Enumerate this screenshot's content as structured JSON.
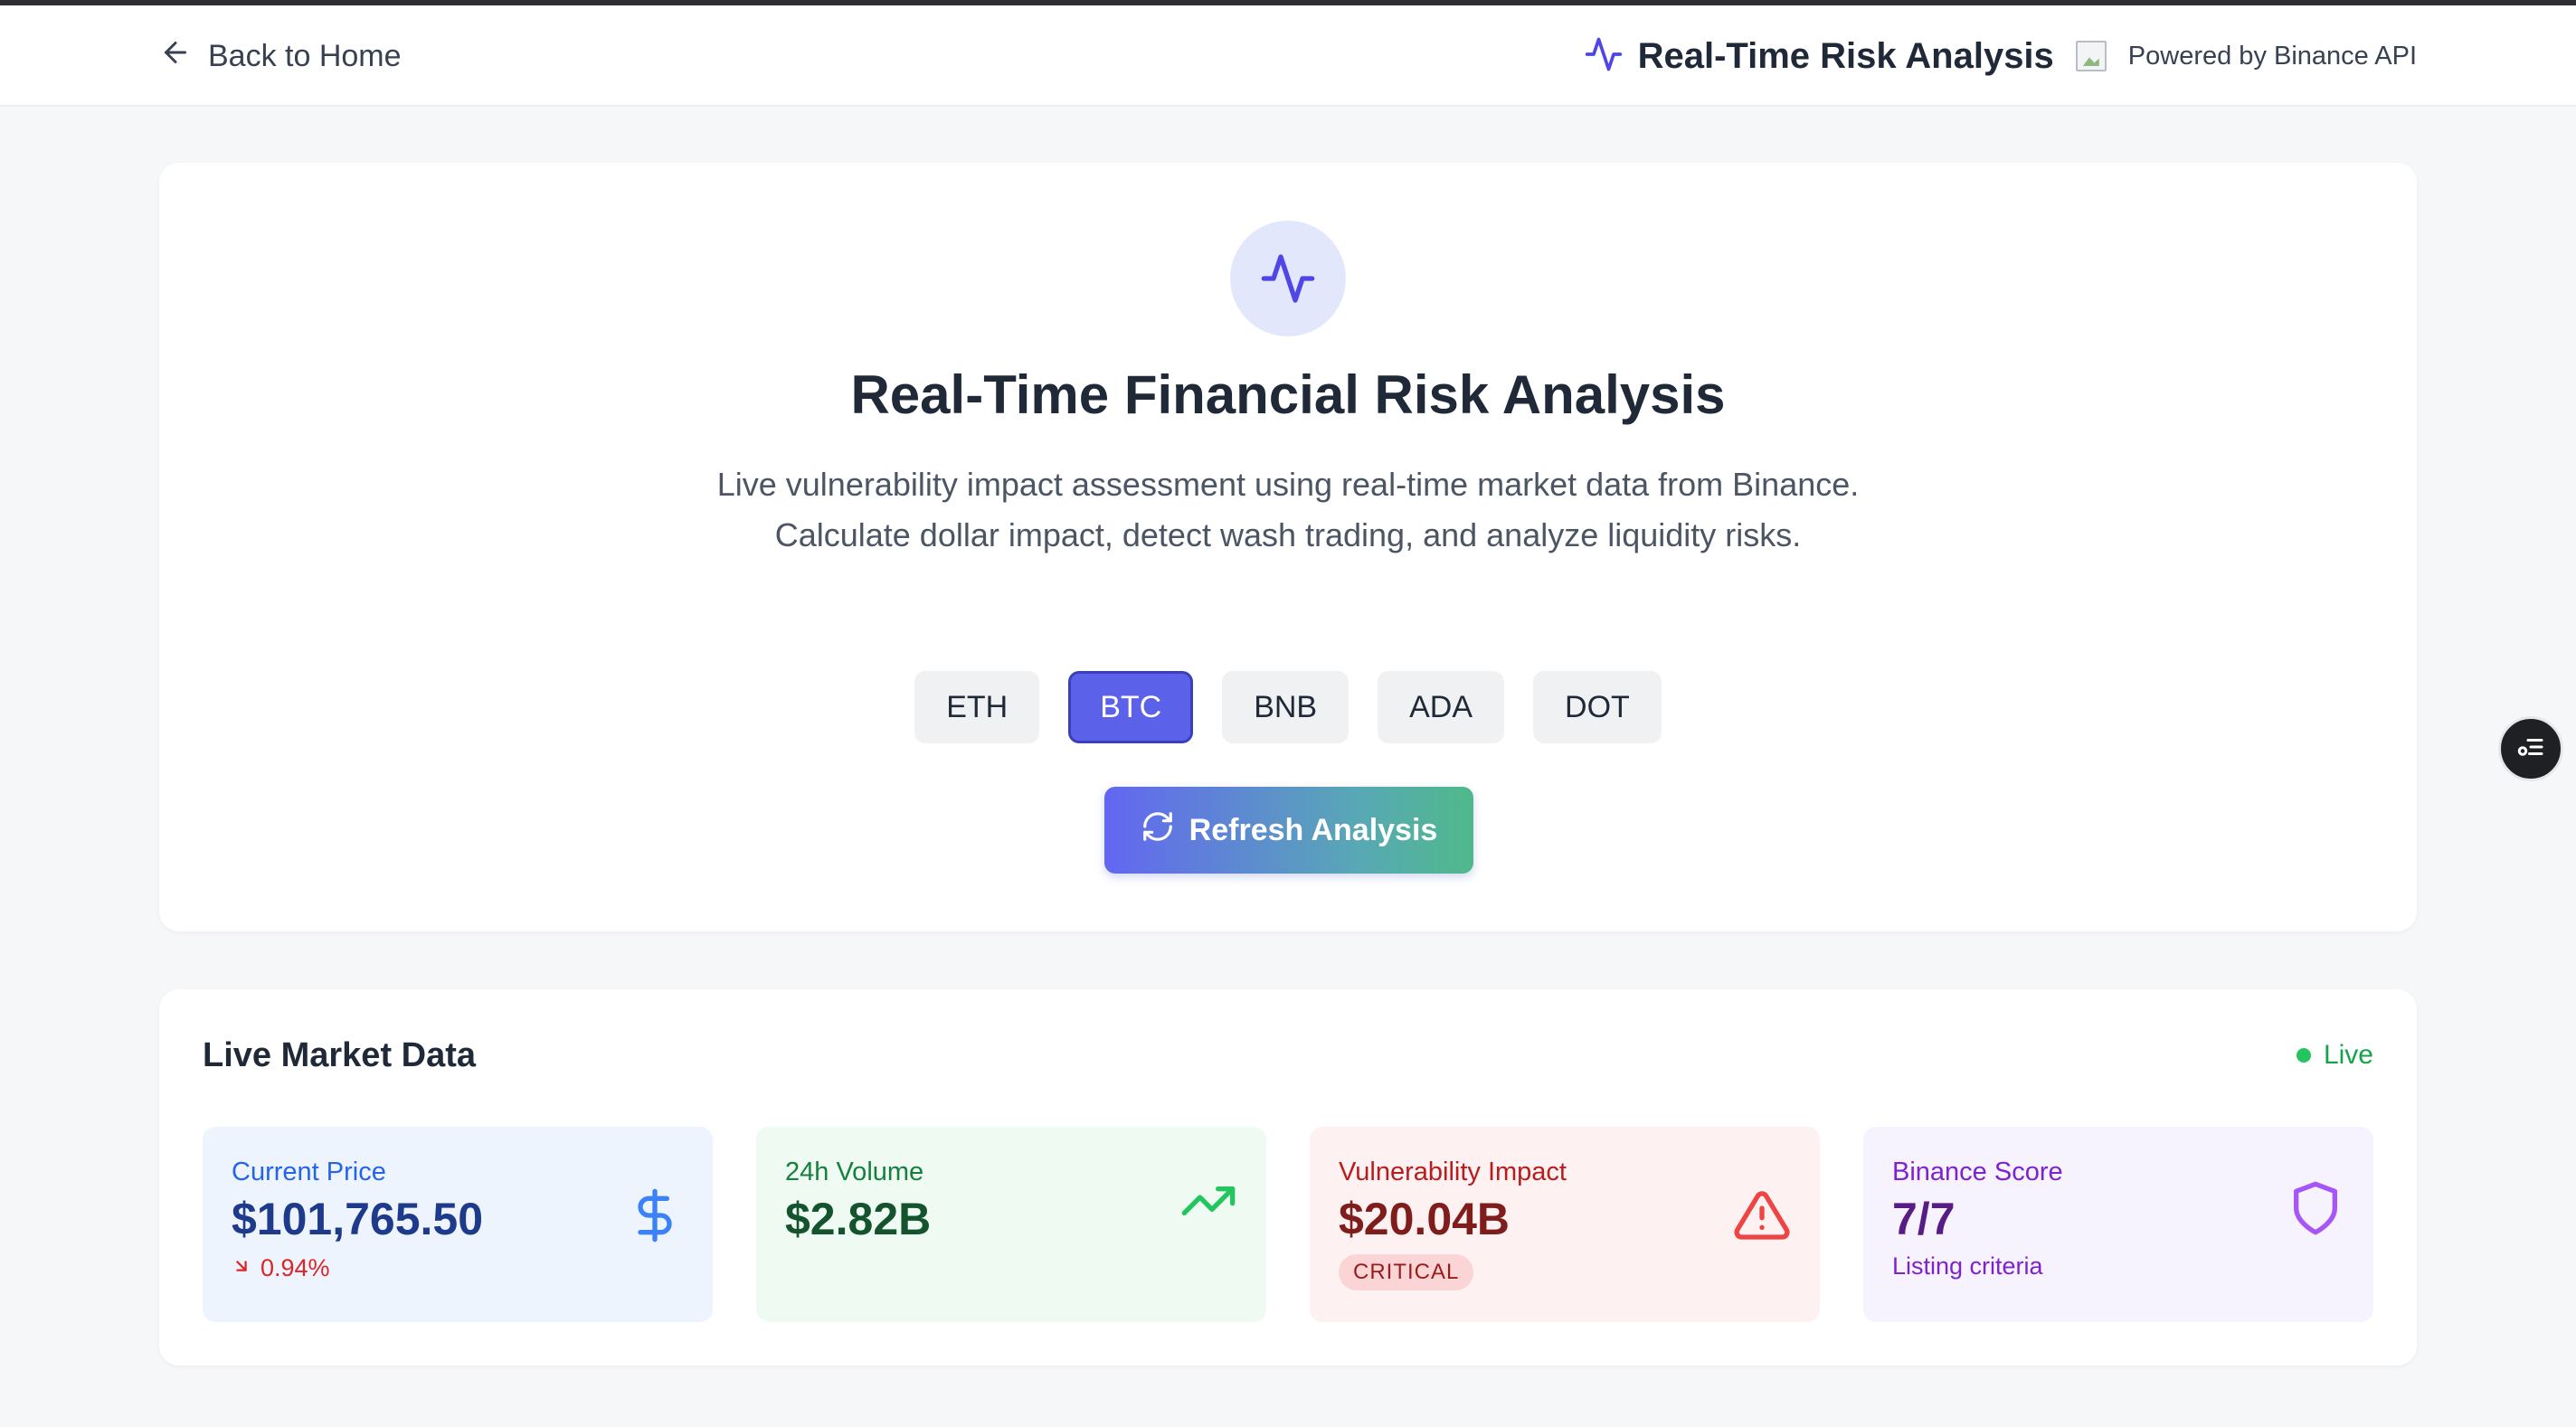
{
  "header": {
    "back_label": "Back to Home",
    "title": "Real-Time Risk Analysis",
    "powered_by": "Powered by Binance API",
    "title_icon": "pulse-icon",
    "back_icon": "arrow-left-icon"
  },
  "hero": {
    "icon": "pulse-icon",
    "title": "Real-Time Financial Risk Analysis",
    "description": "Live vulnerability impact assessment using real-time market data from Binance. Calculate dollar impact, detect wash trading, and analyze liquidity risks.",
    "assets": [
      "ETH",
      "BTC",
      "BNB",
      "ADA",
      "DOT"
    ],
    "selected_asset": "BTC",
    "refresh_label": "Refresh Analysis",
    "refresh_icon": "refresh-icon"
  },
  "market": {
    "title": "Live Market Data",
    "status": "Live",
    "cards": {
      "price": {
        "label": "Current Price",
        "value": "$101,765.50",
        "change": "0.94%",
        "icon": "dollar-icon"
      },
      "volume": {
        "label": "24h Volume",
        "value": "$2.82B",
        "icon": "trending-up-icon"
      },
      "impact": {
        "label": "Vulnerability Impact",
        "value": "$20.04B",
        "badge": "CRITICAL",
        "icon": "warning-triangle-icon"
      },
      "score": {
        "label": "Binance Score",
        "value": "7/7",
        "sub": "Listing criteria",
        "icon": "shield-icon"
      }
    }
  },
  "colors": {
    "accent": "#5b61e8",
    "live_green": "#22c55e",
    "critical_red": "#dc2626",
    "score_purple": "#7e22ce"
  }
}
